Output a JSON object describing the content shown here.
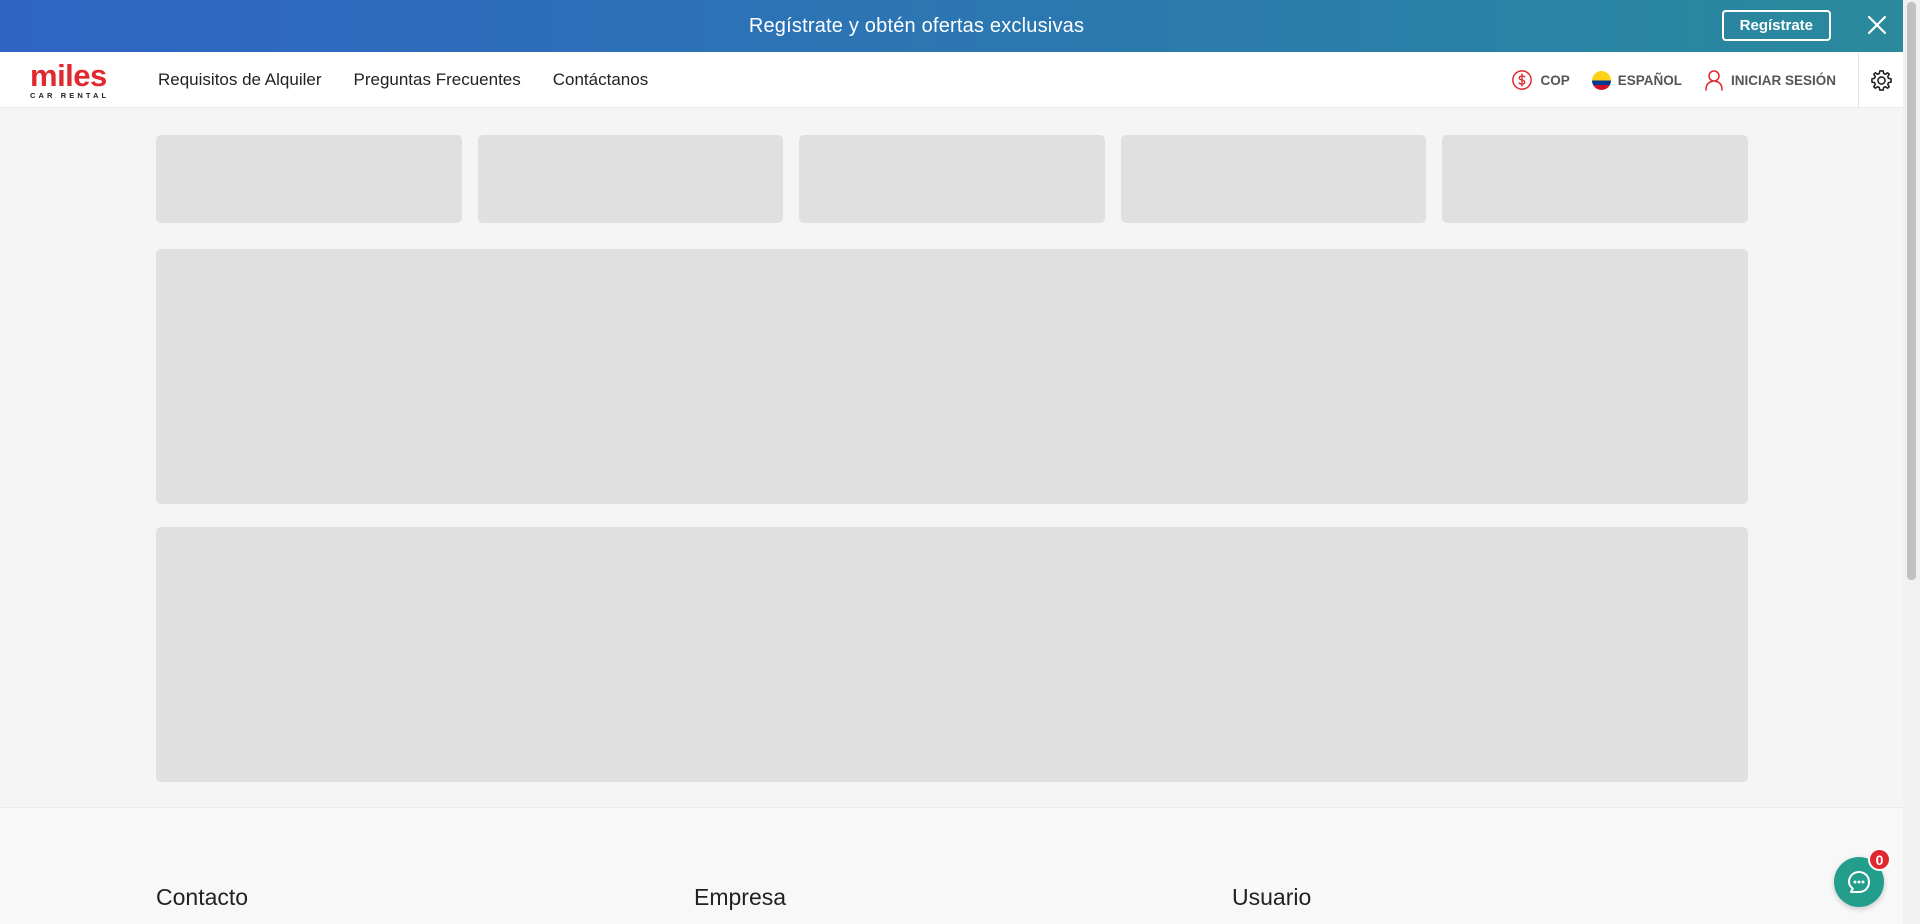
{
  "promo": {
    "text": "Regístrate y obtén ofertas exclusivas",
    "button_label": "Regístrate",
    "close_icon": "close-icon"
  },
  "header": {
    "logo_text": "miles",
    "logo_subtext": "CAR RENTAL",
    "nav": [
      {
        "label": "Requisitos de Alquiler"
      },
      {
        "label": "Preguntas Frecuentes"
      },
      {
        "label": "Contáctanos"
      }
    ],
    "currency": "COP",
    "language": "ESPAÑOL",
    "login": "INICIAR SESIÓN",
    "icons": [
      "dollar-circle-icon",
      "colombia-flag-icon",
      "user-icon",
      "gear-icon"
    ]
  },
  "footer": {
    "columns": [
      {
        "title": "Contacto"
      },
      {
        "title": "Empresa"
      },
      {
        "title": "Usuario"
      }
    ]
  },
  "chat": {
    "badge_count": "0",
    "icon": "chat-support-icon"
  },
  "colors": {
    "brand_red": "#e0282f",
    "promo_gradient_start": "#2f64c4",
    "promo_gradient_end": "#2a8a9c",
    "skeleton": "#e0e0e0",
    "chat_green": "#239d8c"
  }
}
